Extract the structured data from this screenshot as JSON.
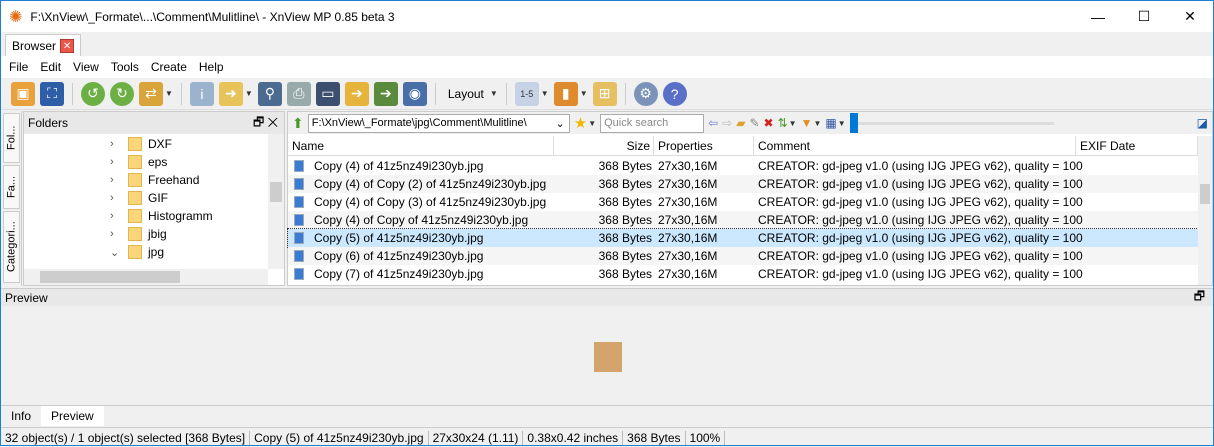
{
  "window": {
    "title": "F:\\XnView\\_Formate\\...\\Comment\\Mulitline\\ - XnView MP 0.85 beta 3"
  },
  "tabs": [
    {
      "label": "Browser"
    }
  ],
  "menu": [
    "File",
    "Edit",
    "View",
    "Tools",
    "Create",
    "Help"
  ],
  "toolbar": {
    "layout_label": "Layout"
  },
  "side_tabs": [
    "Fol...",
    "Fa...",
    "Categori..."
  ],
  "folders": {
    "title": "Folders",
    "items": [
      {
        "name": "DXF",
        "expanded": false
      },
      {
        "name": "eps",
        "expanded": false
      },
      {
        "name": "Freehand",
        "expanded": false
      },
      {
        "name": "GIF",
        "expanded": false
      },
      {
        "name": "Histogramm",
        "expanded": false
      },
      {
        "name": "jbig",
        "expanded": false
      },
      {
        "name": "jpg",
        "expanded": true
      }
    ]
  },
  "address": {
    "path": "F:\\XnView\\_Formate\\jpg\\Comment\\Mulitline\\",
    "search_placeholder": "Quick search",
    "zoom_fraction": 0
  },
  "columns": [
    "Name",
    "Size",
    "Properties",
    "Comment",
    "EXIF Date"
  ],
  "files": [
    {
      "name": "Copy (4) of 41z5nz49i230yb.jpg",
      "size": "368 Bytes",
      "props": "27x30,16M",
      "comment": "CREATOR: gd-jpeg v1.0 (using IJG JPEG v62), quality = 100"
    },
    {
      "name": "Copy (4) of Copy (2) of 41z5nz49i230yb.jpg",
      "size": "368 Bytes",
      "props": "27x30,16M",
      "comment": "CREATOR: gd-jpeg v1.0 (using IJG JPEG v62), quality = 100"
    },
    {
      "name": "Copy (4) of Copy (3) of 41z5nz49i230yb.jpg",
      "size": "368 Bytes",
      "props": "27x30,16M",
      "comment": "CREATOR: gd-jpeg v1.0 (using IJG JPEG v62), quality = 100"
    },
    {
      "name": "Copy (4) of Copy of 41z5nz49i230yb.jpg",
      "size": "368 Bytes",
      "props": "27x30,16M",
      "comment": "CREATOR: gd-jpeg v1.0 (using IJG JPEG v62), quality = 100"
    },
    {
      "name": "Copy (5) of 41z5nz49i230yb.jpg",
      "size": "368 Bytes",
      "props": "27x30,16M",
      "comment": "CREATOR: gd-jpeg v1.0 (using IJG JPEG v62), quality = 100",
      "selected": true
    },
    {
      "name": "Copy (6) of 41z5nz49i230yb.jpg",
      "size": "368 Bytes",
      "props": "27x30,16M",
      "comment": "CREATOR: gd-jpeg v1.0 (using IJG JPEG v62), quality = 100"
    },
    {
      "name": "Copy (7) of 41z5nz49i230yb.jpg",
      "size": "368 Bytes",
      "props": "27x30,16M",
      "comment": "CREATOR: gd-jpeg v1.0 (using IJG JPEG v62), quality = 100"
    }
  ],
  "preview": {
    "title": "Preview"
  },
  "bottom_tabs": [
    "Info",
    "Preview"
  ],
  "status": [
    "32 object(s) / 1 object(s) selected [368 Bytes]",
    "Copy (5) of 41z5nz49i230yb.jpg",
    "27x30x24 (1.11)",
    "0.38x0.42 inches",
    "368 Bytes",
    "100%"
  ],
  "colors": {
    "selection": "#cce8ff",
    "accent": "#0078d7"
  }
}
